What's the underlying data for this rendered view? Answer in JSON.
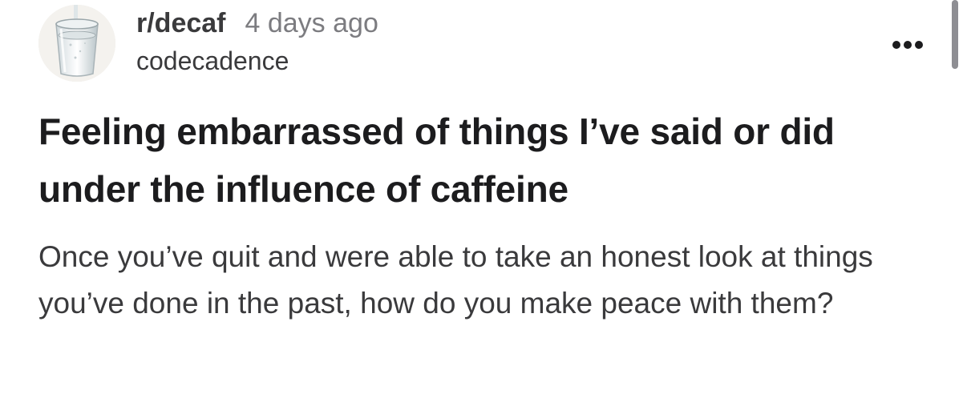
{
  "post": {
    "subreddit": "r/decaf",
    "time_ago": "4 days ago",
    "author": "codecadence",
    "title": "Feeling embarrassed of things I’ve said or did under the influence of caffeine",
    "body": "Once you’ve quit and were able to take an honest look at things you’ve done in the past, how do you make peace with them?"
  },
  "icons": {
    "avatar": "water-glass-icon",
    "more": "more-options-icon"
  }
}
